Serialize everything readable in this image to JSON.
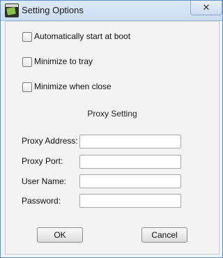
{
  "window": {
    "title": "Setting Options",
    "close_label": "✕"
  },
  "options": {
    "autostart": {
      "label": "Automatically start at boot",
      "checked": false
    },
    "minimize_tray": {
      "label": "Minimize to tray",
      "checked": false
    },
    "minimize_close": {
      "label": "Minimize when close",
      "checked": false
    }
  },
  "proxy": {
    "section_title": "Proxy Setting",
    "address": {
      "label": "Proxy Address:",
      "value": ""
    },
    "port": {
      "label": "Proxy Port:",
      "value": ""
    },
    "username": {
      "label": "User Name:",
      "value": ""
    },
    "password": {
      "label": "Password:",
      "value": ""
    }
  },
  "buttons": {
    "ok": "OK",
    "cancel": "Cancel"
  }
}
